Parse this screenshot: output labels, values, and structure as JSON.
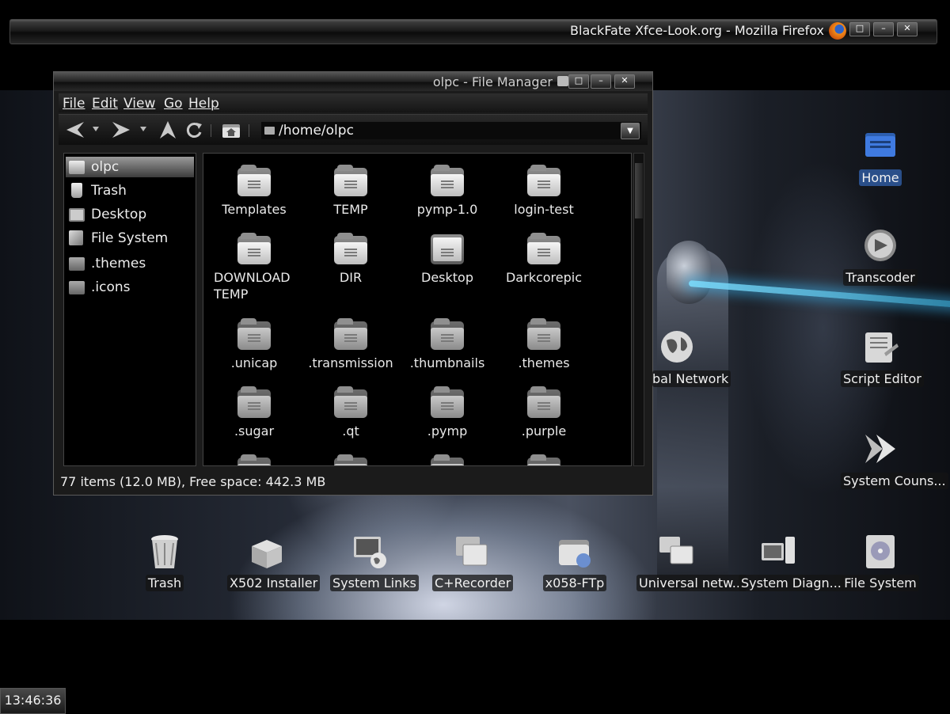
{
  "firefox": {
    "title": "BlackFate Xfce-Look.org - Mozilla Firefox",
    "restore": "□",
    "minimize": "–",
    "close": "✕"
  },
  "file_manager": {
    "title": "olpc - File Manager",
    "window_buttons": {
      "restore": "□",
      "minimize": "–",
      "close": "✕"
    },
    "menu": [
      "File",
      "Edit",
      "View",
      "Go",
      "Help"
    ],
    "path": "/home/olpc",
    "sidebar": [
      {
        "label": "olpc",
        "icon": "home-folder-icon",
        "selected": true
      },
      {
        "label": "Trash",
        "icon": "trash-icon"
      },
      {
        "label": "Desktop",
        "icon": "desktop-icon"
      },
      {
        "label": "File System",
        "icon": "filesystem-icon"
      },
      {
        "label": ".themes",
        "icon": "folder-icon"
      },
      {
        "label": ".icons",
        "icon": "folder-icon"
      }
    ],
    "items": [
      "Templates",
      "TEMP",
      "pymp-1.0",
      "login-test",
      "DOWNLOAD TEMP",
      "DIR",
      "Desktop",
      "Darkcorepic",
      ".unicap",
      ".transmission",
      ".thumbnails",
      ".themes",
      ".sugar",
      ".qt",
      ".pymp",
      ".purple"
    ],
    "status": "77 items (12.0 MB), Free space: 442.3 MB"
  },
  "desktop_icons": {
    "right": [
      "Home",
      "Transcoder",
      "Script Editor",
      "System Couns..."
    ],
    "middle": "bal Network",
    "bottom": [
      "Trash",
      "X502 Installer",
      "System Links",
      "C+Recorder",
      "x058-FTp",
      "Universal netw...",
      "System Diagn...",
      "File System"
    ]
  },
  "clock": "13:46:36",
  "colors": {
    "selection": "#2a4f8a",
    "beam": "#3cc8ff"
  }
}
